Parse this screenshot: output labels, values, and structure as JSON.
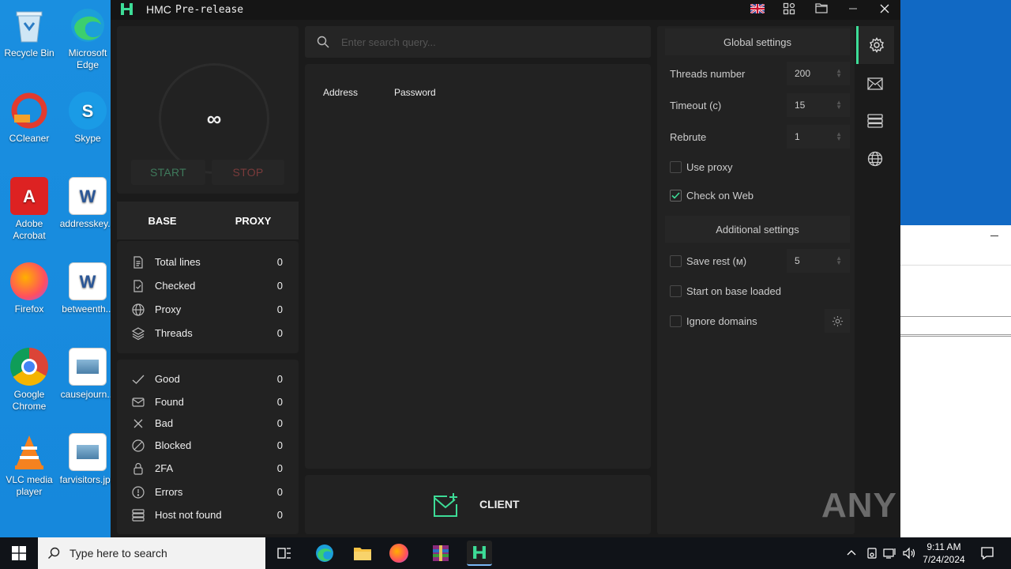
{
  "desktop": {
    "icons": [
      {
        "label": "Recycle Bin",
        "icon": "recycle-bin-icon"
      },
      {
        "label": "Microsoft Edge",
        "icon": "edge-icon"
      },
      {
        "label": "CCleaner",
        "icon": "ccleaner-icon"
      },
      {
        "label": "Skype",
        "icon": "skype-icon"
      },
      {
        "label": "Adobe Acrobat",
        "icon": "acrobat-icon"
      },
      {
        "label": "addresskey...",
        "icon": "word-doc-icon"
      },
      {
        "label": "Firefox",
        "icon": "firefox-icon"
      },
      {
        "label": "betweenth...",
        "icon": "word-doc-icon"
      },
      {
        "label": "Google Chrome",
        "icon": "chrome-icon"
      },
      {
        "label": "causejourn...",
        "icon": "image-file-icon"
      },
      {
        "label": "VLC media player",
        "icon": "vlc-icon"
      },
      {
        "label": "farvisitors.jpg",
        "icon": "image-file-icon"
      }
    ]
  },
  "window": {
    "title": "HMC",
    "subtitle": "Pre-release",
    "accent": "#3ddc97"
  },
  "control": {
    "counter": "∞",
    "start_label": "START",
    "stop_label": "STOP",
    "start_color": "#3f7a5c",
    "stop_color": "#7a3b3b"
  },
  "tabs": {
    "base": "BASE",
    "proxy": "PROXY"
  },
  "stats": [
    {
      "label": "Total lines",
      "value": "0",
      "icon": "file-icon"
    },
    {
      "label": "Checked",
      "value": "0",
      "icon": "file-check-icon"
    },
    {
      "label": "Proxy",
      "value": "0",
      "icon": "globe-icon"
    },
    {
      "label": "Threads",
      "value": "0",
      "icon": "layers-icon"
    }
  ],
  "results": [
    {
      "label": "Good",
      "value": "0",
      "icon": "check-icon"
    },
    {
      "label": "Found",
      "value": "0",
      "icon": "mail-icon"
    },
    {
      "label": "Bad",
      "value": "0",
      "icon": "x-icon"
    },
    {
      "label": "Blocked",
      "value": "0",
      "icon": "blocked-icon"
    },
    {
      "label": "2FA",
      "value": "0",
      "icon": "lock-icon"
    },
    {
      "label": "Errors",
      "value": "0",
      "icon": "alert-icon"
    },
    {
      "label": "Host not found",
      "value": "0",
      "icon": "server-icon"
    }
  ],
  "search": {
    "placeholder": "Enter search query..."
  },
  "table": {
    "columns": [
      "Address",
      "Password"
    ]
  },
  "client": {
    "label": "CLIENT"
  },
  "settings": {
    "global_title": "Global settings",
    "threads_label": "Threads number",
    "threads_value": "200",
    "timeout_label": "Timeout (c)",
    "timeout_value": "15",
    "rebrute_label": "Rebrute",
    "rebrute_value": "1",
    "use_proxy_label": "Use proxy",
    "use_proxy_checked": false,
    "check_web_label": "Check on Web",
    "check_web_checked": true,
    "additional_title": "Additional settings",
    "save_rest_label": "Save rest (м)",
    "save_rest_value": "5",
    "start_on_base_label": "Start on base loaded",
    "ignore_domains_label": "Ignore domains"
  },
  "taskbar": {
    "search_placeholder": "Type here to search",
    "time": "9:11 AM",
    "date": "7/24/2024"
  },
  "watermark": "ANY RUN"
}
